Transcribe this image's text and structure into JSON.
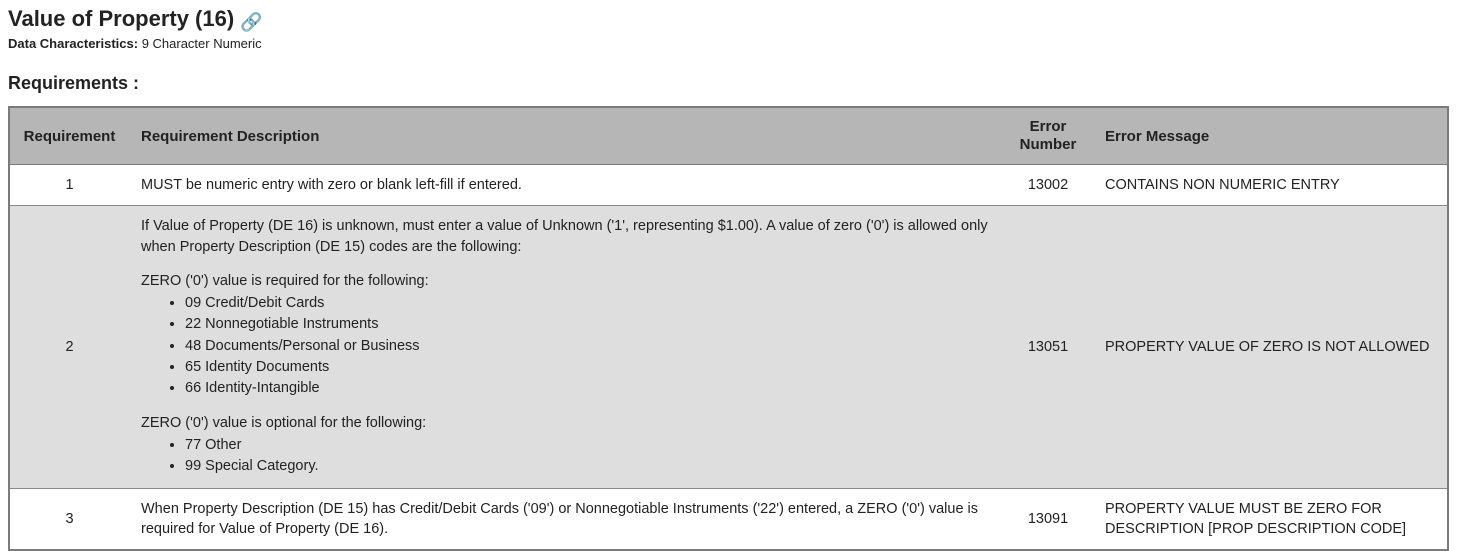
{
  "title": "Value of Property (16)",
  "data_characteristics_label": "Data Characteristics:",
  "data_characteristics_value": "9 Character Numeric",
  "requirements_heading": "Requirements :",
  "table": {
    "headers": {
      "requirement": "Requirement",
      "description": "Requirement Description",
      "error_number_l1": "Error",
      "error_number_l2": "Number",
      "error_message": "Error Message"
    },
    "rows": [
      {
        "num": "1",
        "desc_simple": "MUST be numeric entry with zero or blank left-fill if entered.",
        "error_number": "13002",
        "error_message": "CONTAINS NON NUMERIC ENTRY"
      },
      {
        "num": "2",
        "desc_intro": "If Value of Property (DE 16) is unknown, must enter a value of Unknown ('1', representing $1.00). A value of zero ('0') is allowed only when Property Description (DE 15) codes are the following:",
        "req_label": "ZERO ('0') value is required for the following:",
        "req_items": [
          "09 Credit/Debit Cards",
          "22 Nonnegotiable Instruments",
          "48 Documents/Personal or Business",
          "65 Identity Documents",
          "66 Identity-Intangible"
        ],
        "opt_label": "ZERO ('0') value is optional for the following:",
        "opt_items": [
          "77 Other",
          "99 Special Category."
        ],
        "error_number": "13051",
        "error_message": "PROPERTY VALUE OF ZERO IS NOT ALLOWED"
      },
      {
        "num": "3",
        "desc_simple": "When Property Description (DE 15) has Credit/Debit Cards ('09') or Nonnegotiable Instruments ('22') entered, a ZERO ('0') value is required for Value of Property (DE 16).",
        "error_number": "13091",
        "error_message": "PROPERTY VALUE MUST BE ZERO FOR DESCRIPTION [PROP DESCRIPTION CODE]"
      }
    ]
  }
}
